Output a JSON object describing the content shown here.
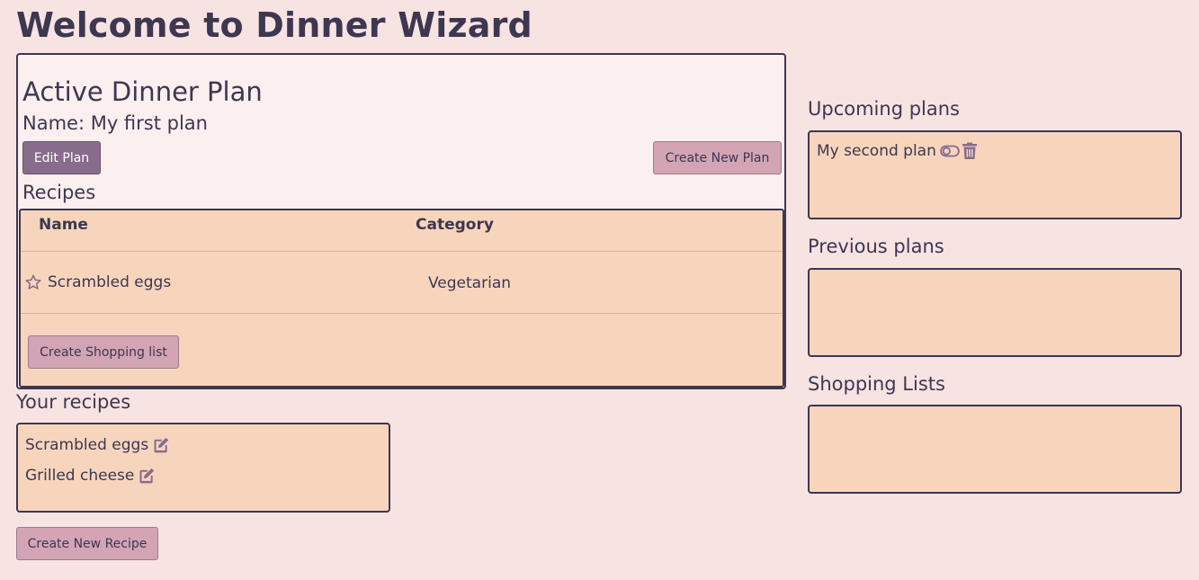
{
  "page": {
    "title": "Welcome to Dinner Wizard"
  },
  "active_plan": {
    "heading": "Active Dinner Plan",
    "name_label": "Name: My first plan",
    "edit_button": "Edit Plan",
    "create_button": "Create New Plan",
    "recipes_heading": "Recipes",
    "table": {
      "columns": [
        "Name",
        "Category"
      ],
      "rows": [
        {
          "name": "Scrambled eggs",
          "category": "Vegetarian",
          "starred": false
        }
      ]
    },
    "shopping_button": "Create Shopping list"
  },
  "your_recipes": {
    "heading": "Your recipes",
    "items": [
      "Scrambled eggs",
      "Grilled cheese"
    ],
    "create_button": "Create New Recipe"
  },
  "sidebar": {
    "upcoming": {
      "heading": "Upcoming plans",
      "items": [
        "My second plan"
      ]
    },
    "previous": {
      "heading": "Previous plans",
      "items": []
    },
    "shopping": {
      "heading": "Shopping Lists",
      "items": []
    }
  },
  "colors": {
    "background": "#f8e3e3",
    "panel": "#fbefef",
    "card": "#f7d5bd",
    "primary": "#876c8b",
    "secondary": "#d3a4b3",
    "text": "#3d3750"
  },
  "icons": {
    "star": "star-outline-icon",
    "edit": "edit-icon",
    "toggle": "toggle-icon",
    "trash": "trash-icon"
  }
}
